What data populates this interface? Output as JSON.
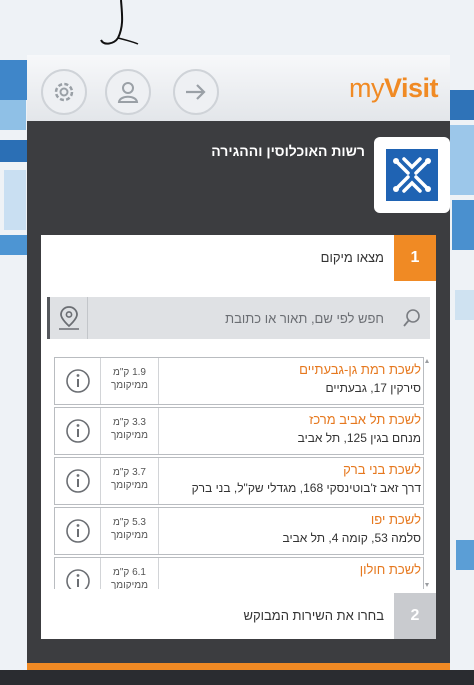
{
  "app": {
    "logo_prefix": "my",
    "logo_suffix": "Visit",
    "accent": "#f08a24"
  },
  "toolbar": {
    "icons": [
      "gear-icon",
      "user-icon",
      "login-arrow-icon"
    ]
  },
  "agency": {
    "name": "רשות האוכלוסין וההגירה"
  },
  "steps": [
    {
      "number": "1",
      "label": "מצאו מיקום"
    },
    {
      "number": "2",
      "label": "בחרו את השירות המבוקש"
    }
  ],
  "search": {
    "placeholder": "חפש לפי שם, תאור או כתובת"
  },
  "branches": [
    {
      "name": "לשכת רמת גן-גבעתיים",
      "address": "סירקין 17, גבעתיים",
      "distance": "1.9 ק\"מ",
      "from_label": "ממיקומך"
    },
    {
      "name": "לשכת תל אביב מרכז",
      "address": "מנחם בגין 125, תל אביב",
      "distance": "3.3 ק\"מ",
      "from_label": "ממיקומך"
    },
    {
      "name": "לשכת בני ברק",
      "address": "דרך זאב ז'בוטינסקי 168, מגדלי שק\"ל, בני ברק",
      "distance": "3.7 ק\"מ",
      "from_label": "ממיקומך"
    },
    {
      "name": "לשכת יפו",
      "address": "סלמה 53, קומה 4, תל אביב",
      "distance": "5.3 ק\"מ",
      "from_label": "ממיקומך"
    },
    {
      "name": "לשכת חולון",
      "address": "",
      "distance": "6.1 ק\"מ",
      "from_label": "ממיקומך"
    }
  ]
}
